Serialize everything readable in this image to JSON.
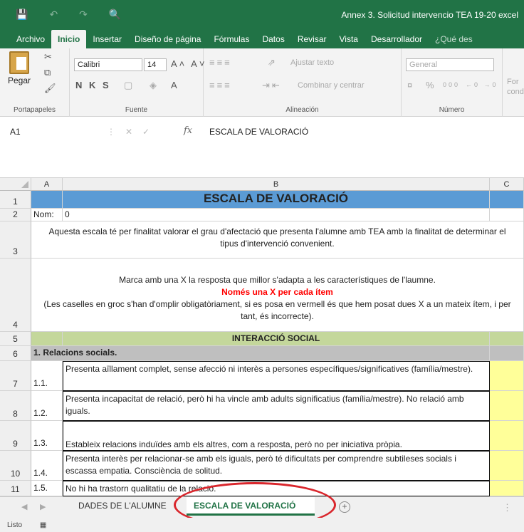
{
  "window": {
    "title": "Annex 3. Solicitud intervencio TEA  19-20 excel",
    "qat_icons": [
      "save-icon",
      "undo-icon",
      "redo-icon",
      "preview-icon"
    ]
  },
  "ribbon_tabs": [
    "Archivo",
    "Inicio",
    "Insertar",
    "Diseño de página",
    "Fórmulas",
    "Datos",
    "Revisar",
    "Vista",
    "Desarrollador",
    "¿Qué des"
  ],
  "ribbon": {
    "paste_label": "Pegar",
    "clipboard_label": "Portapapeles",
    "font_name": "Calibri",
    "font_size": "14",
    "grow_shrink": "A˄ A˅",
    "bold_italic_underline": "N K S",
    "font_label": "Fuente",
    "wrap_text": "Ajustar texto",
    "merge_center": "Combinar y centrar",
    "alignment_label": "Alineación",
    "number_format": "General",
    "number_label": "Número",
    "conditional_fmt": "For cond",
    "font_color_letter": "A"
  },
  "formula_bar": {
    "cell_ref": "A1",
    "content": "ESCALA DE VALORACIÓ",
    "fx": "fx"
  },
  "grid": {
    "columns": [
      "A",
      "B",
      "C"
    ],
    "rows": [
      "1",
      "2",
      "3",
      "4",
      "5",
      "6",
      "7",
      "8",
      "9",
      "10",
      "11"
    ],
    "r1_title": "ESCALA DE VALORACIÓ",
    "r2_label": "Nom:",
    "r2_value": "0",
    "r3_text": "Aquesta escala té per  finalitat valorar el grau d'afectació que presenta l'alumne amb TEA  amb la finalitat de determinar el tipus d'intervenció convenient.",
    "r4_line1": "Marca amb una X la resposta que millor s'adapta a les característiques de l'laumne.",
    "r4_red": "Només una X per cada ítem",
    "r4_line3": "(Les caselles en groc s'han d'omplir obligatòriament, si es posa en vermell és que hem posat dues X a un mateix ítem, i per tant, és incorrecte).",
    "r5_section": "INTERACCIÓ SOCIAL",
    "r6_sub": "1. Relacions socials.",
    "items": [
      {
        "code": "1.1.",
        "text": "Presenta aïllament complet, sense afecció ni interès a persones específiques/significatives (família/mestre)."
      },
      {
        "code": "1.2.",
        "text": "Presenta incapacitat de relació, però hi ha vincle amb adults significatius (família/mestre). No relació amb iguals."
      },
      {
        "code": "1.3.",
        "text": "Estableix relacions induïdes amb els altres, com a resposta, però no per iniciativa pròpia."
      },
      {
        "code": "1.4.",
        "text": "Presenta interès per relacionar-se amb els iguals, però té dificultats per comprendre subtileses socials i escassa empatia. Consciència de solitud."
      },
      {
        "code": "1.5.",
        "text": "No hi ha trastorn qualitatiu de la relació."
      }
    ]
  },
  "sheet_tabs": [
    "DADES DE L'ALUMNE",
    "ESCALA DE VALORACIÓ"
  ],
  "status": {
    "text": "Listo"
  },
  "colors": {
    "excel_green": "#217346",
    "title_blue": "#5b9bd5",
    "section_green": "#c4d79b",
    "answer_yellow": "#ffff99",
    "annotation_red": "#d9262c"
  }
}
